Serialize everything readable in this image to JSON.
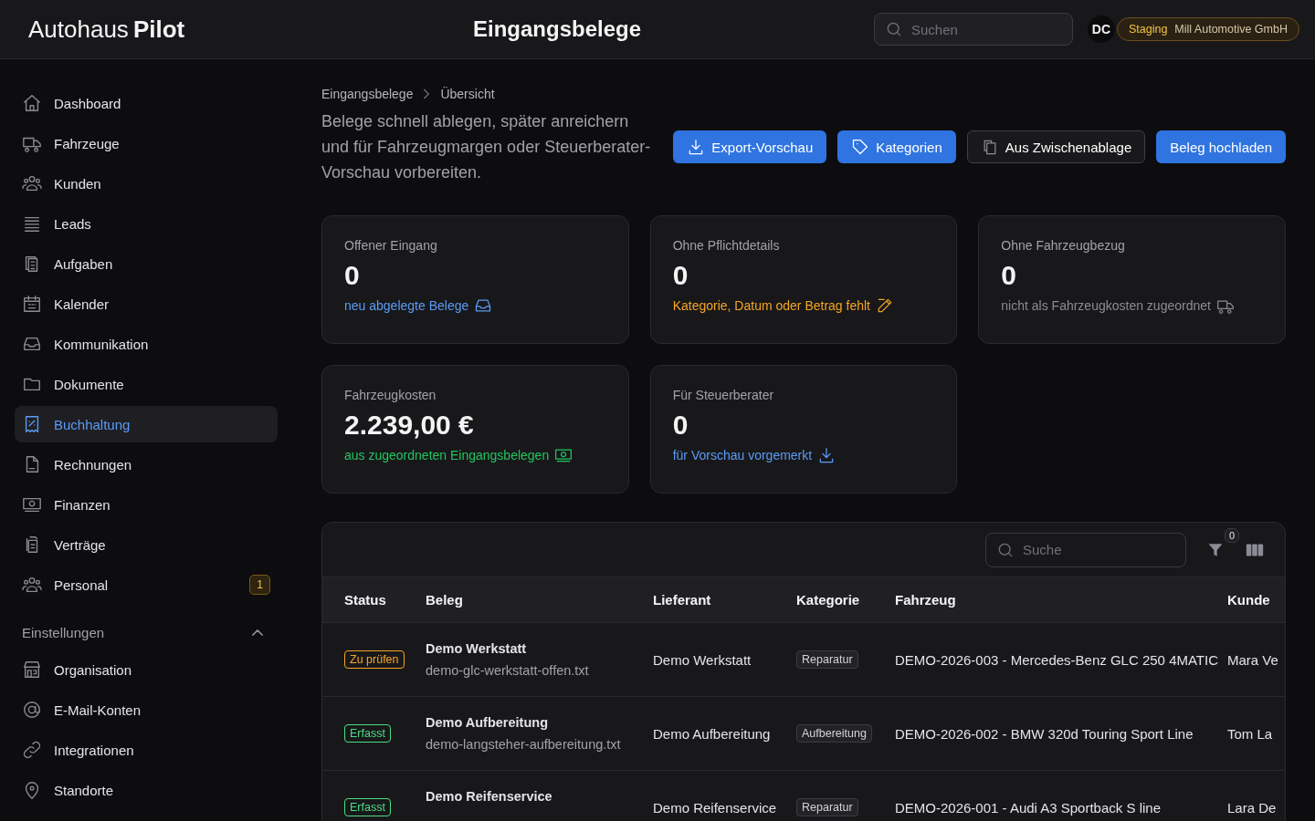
{
  "header": {
    "logo_light": "Autohaus",
    "logo_bold": "Pilot",
    "title": "Eingangsbelege",
    "search": {
      "placeholder": "Suchen"
    },
    "avatar": "DC",
    "environment": "Staging",
    "company": "Mill Automotive GmbH"
  },
  "sidebar": {
    "items": [
      {
        "label": "Dashboard",
        "selected": false
      },
      {
        "label": "Fahrzeuge",
        "selected": false
      },
      {
        "label": "Kunden",
        "selected": false
      },
      {
        "label": "Leads",
        "selected": false
      },
      {
        "label": "Aufgaben",
        "selected": false
      },
      {
        "label": "Kalender",
        "selected": false
      },
      {
        "label": "Kommunikation",
        "selected": false
      },
      {
        "label": "Dokumente",
        "selected": false
      },
      {
        "label": "Buchhaltung",
        "selected": true
      },
      {
        "label": "Rechnungen",
        "selected": false
      },
      {
        "label": "Finanzen",
        "selected": false
      },
      {
        "label": "Verträge",
        "selected": false
      },
      {
        "label": "Personal",
        "selected": false,
        "badge": "1"
      }
    ],
    "section": {
      "label": "Einstellungen",
      "expanded": true,
      "items": [
        {
          "label": "Organisation",
          "selected": false
        },
        {
          "label": "E-Mail-Konten",
          "selected": false
        },
        {
          "label": "Integrationen",
          "selected": false
        },
        {
          "label": "Standorte",
          "selected": false
        }
      ]
    }
  },
  "breadcrumb": [
    "Eingangsbelege",
    "Übersicht"
  ],
  "description": "Belege schnell ablegen, später anreichern und für Fahrzeugmargen oder Steuerberater-Vorschau vorbereiten.",
  "actions": [
    {
      "label": "Export-Vorschau",
      "kind": "primary"
    },
    {
      "label": "Kategorien",
      "kind": "primary"
    },
    {
      "label": "Aus Zwischenablage",
      "kind": "secondary"
    },
    {
      "label": "Beleg hochladen",
      "kind": "primary"
    }
  ],
  "stats": [
    {
      "label": "Offener Eingang",
      "value": "0",
      "note": "neu abgelegte Belege",
      "color": "#5b9bf5"
    },
    {
      "label": "Ohne Pflichtdetails",
      "value": "0",
      "note": "Kategorie, Datum oder Betrag fehlt",
      "color": "#f5a524"
    },
    {
      "label": "Ohne Fahrzeugbezug",
      "value": "0",
      "note": "nicht als Fahrzeugkosten zugeordnet",
      "color": "#8b8b94"
    },
    {
      "label": "Fahrzeugkosten",
      "value": "2.239,00 €",
      "note": "aus zugeordneten Eingangsbelegen",
      "color": "#22c55e"
    },
    {
      "label": "Für Steuerberater",
      "value": "0",
      "note": "für Vorschau vorgemerkt",
      "color": "#5b9bf5"
    }
  ],
  "table": {
    "search": {
      "placeholder": "Suche"
    },
    "filter_count": "0",
    "columns": [
      "Status",
      "Beleg",
      "Lieferant",
      "Kategorie",
      "Fahrzeug",
      "Kunde"
    ],
    "rows": [
      {
        "status": "Zu prüfen",
        "color": "#f5a524",
        "title": "Demo Werkstatt",
        "file": "demo-glc-werkstatt-offen.txt",
        "supplier": "Demo Werkstatt",
        "category": "Reparatur",
        "vehicle": "DEMO-2026-003 - Mercedes-Benz GLC 250 4MATIC",
        "customer": "Mara Ve"
      },
      {
        "status": "Erfasst",
        "color": "#4ade80",
        "title": "Demo Aufbereitung",
        "file": "demo-langsteher-aufbereitung.txt",
        "supplier": "Demo Aufbereitung",
        "category": "Aufbereitung",
        "vehicle": "DEMO-2026-002 - BMW 320d Touring Sport Line",
        "customer": "Tom La"
      },
      {
        "status": "Erfasst",
        "color": "#4ade80",
        "title": "Demo Reifenservice",
        "supplier": "Demo Reifenservice",
        "category": "Reparatur",
        "vehicle": "DEMO-2026-001 - Audi A3 Sportback S line",
        "customer": "Lara De"
      }
    ]
  }
}
